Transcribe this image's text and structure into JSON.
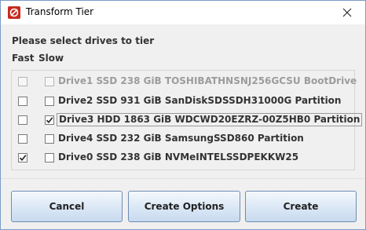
{
  "window": {
    "title": "Transform Tier"
  },
  "prompt": "Please select drives to tier",
  "columns": {
    "fast": "Fast",
    "slow": "Slow"
  },
  "drives": [
    {
      "label": "Drive1  SSD  238 GiB  TOSHIBATHNSNJ256GCSU BootDrive",
      "fast_checked": false,
      "slow_checked": false,
      "disabled": true,
      "focused": false
    },
    {
      "label": "Drive2  SSD  931 GiB  SanDiskSDSSDH31000G Partition",
      "fast_checked": false,
      "slow_checked": false,
      "disabled": false,
      "focused": false
    },
    {
      "label": "Drive3  HDD  1863 GiB  WDCWD20EZRZ-00Z5HB0 Partition",
      "fast_checked": false,
      "slow_checked": true,
      "disabled": false,
      "focused": true
    },
    {
      "label": "Drive4  SSD  232 GiB  SamsungSSD860 Partition",
      "fast_checked": false,
      "slow_checked": false,
      "disabled": false,
      "focused": false
    },
    {
      "label": "Drive0  SSD  238 GiB  NVMeINTELSSDPEKKW25",
      "fast_checked": true,
      "slow_checked": false,
      "disabled": false,
      "focused": false
    }
  ],
  "buttons": {
    "cancel": "Cancel",
    "create_options": "Create Options",
    "create": "Create"
  },
  "colors": {
    "app_icon": "#c62b1f",
    "button_border": "#6f8cb4",
    "disabled_text": "#9c9c9c"
  }
}
